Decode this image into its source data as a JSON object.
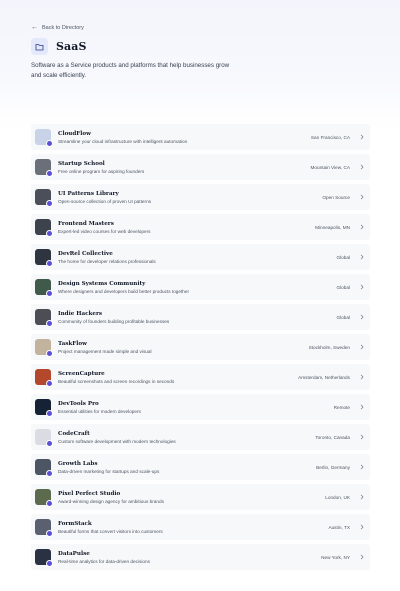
{
  "back_label": "Back to Directory",
  "category": {
    "title": "SaaS",
    "description": "Software as a Service products and platforms that help businesses grow and scale efficiently.",
    "icon": "folder-icon"
  },
  "colors": {
    "accent": "#5a4fd6",
    "row_bg": "#f7f8fa"
  },
  "companies": [
    {
      "name": "CloudFlow",
      "tagline": "Streamline your cloud infrastructure with intelligent automation",
      "location": "San Francisco, CA",
      "thumb": "#c9d3e8"
    },
    {
      "name": "Startup School",
      "tagline": "Free online program for aspiring founders",
      "location": "Mountain View, CA",
      "thumb": "#6b6f7a"
    },
    {
      "name": "UI Patterns Library",
      "tagline": "Open-source collection of proven UI patterns",
      "location": "Open Source",
      "thumb": "#4a4f5a"
    },
    {
      "name": "Frontend Masters",
      "tagline": "Expert-led video courses for web developers",
      "location": "Minneapolis, MN",
      "thumb": "#3d434d"
    },
    {
      "name": "DevRel Collective",
      "tagline": "The home for developer relations professionals",
      "location": "Global",
      "thumb": "#2e3440"
    },
    {
      "name": "Design Systems Community",
      "tagline": "Where designers and developers build better products together",
      "location": "Global",
      "thumb": "#3f5a4a"
    },
    {
      "name": "Indie Hackers",
      "tagline": "Community of founders building profitable businesses",
      "location": "Global",
      "thumb": "#4b4f55"
    },
    {
      "name": "TaskFlow",
      "tagline": "Project management made simple and visual",
      "location": "Stockholm, Sweden",
      "thumb": "#c2b39e"
    },
    {
      "name": "ScreenCapture",
      "tagline": "Beautiful screenshots and screen recordings in seconds",
      "location": "Amsterdam, Netherlands",
      "thumb": "#b4482c"
    },
    {
      "name": "DevTools Pro",
      "tagline": "Essential utilities for modern developers",
      "location": "Remote",
      "thumb": "#152236"
    },
    {
      "name": "CodeCraft",
      "tagline": "Custom software development with modern technologies",
      "location": "Toronto, Canada",
      "thumb": "#d9dde3"
    },
    {
      "name": "Growth Labs",
      "tagline": "Data-driven marketing for startups and scale-ups",
      "location": "Berlin, Germany",
      "thumb": "#4c5563"
    },
    {
      "name": "Pixel Perfect Studio",
      "tagline": "Award-winning design agency for ambitious brands",
      "location": "London, UK",
      "thumb": "#5c6b4e"
    },
    {
      "name": "FormStack",
      "tagline": "Beautiful forms that convert visitors into customers",
      "location": "Austin, TX",
      "thumb": "#5a6070"
    },
    {
      "name": "DataPulse",
      "tagline": "Real-time analytics for data-driven decisions",
      "location": "New York, NY",
      "thumb": "#2a3142"
    }
  ]
}
